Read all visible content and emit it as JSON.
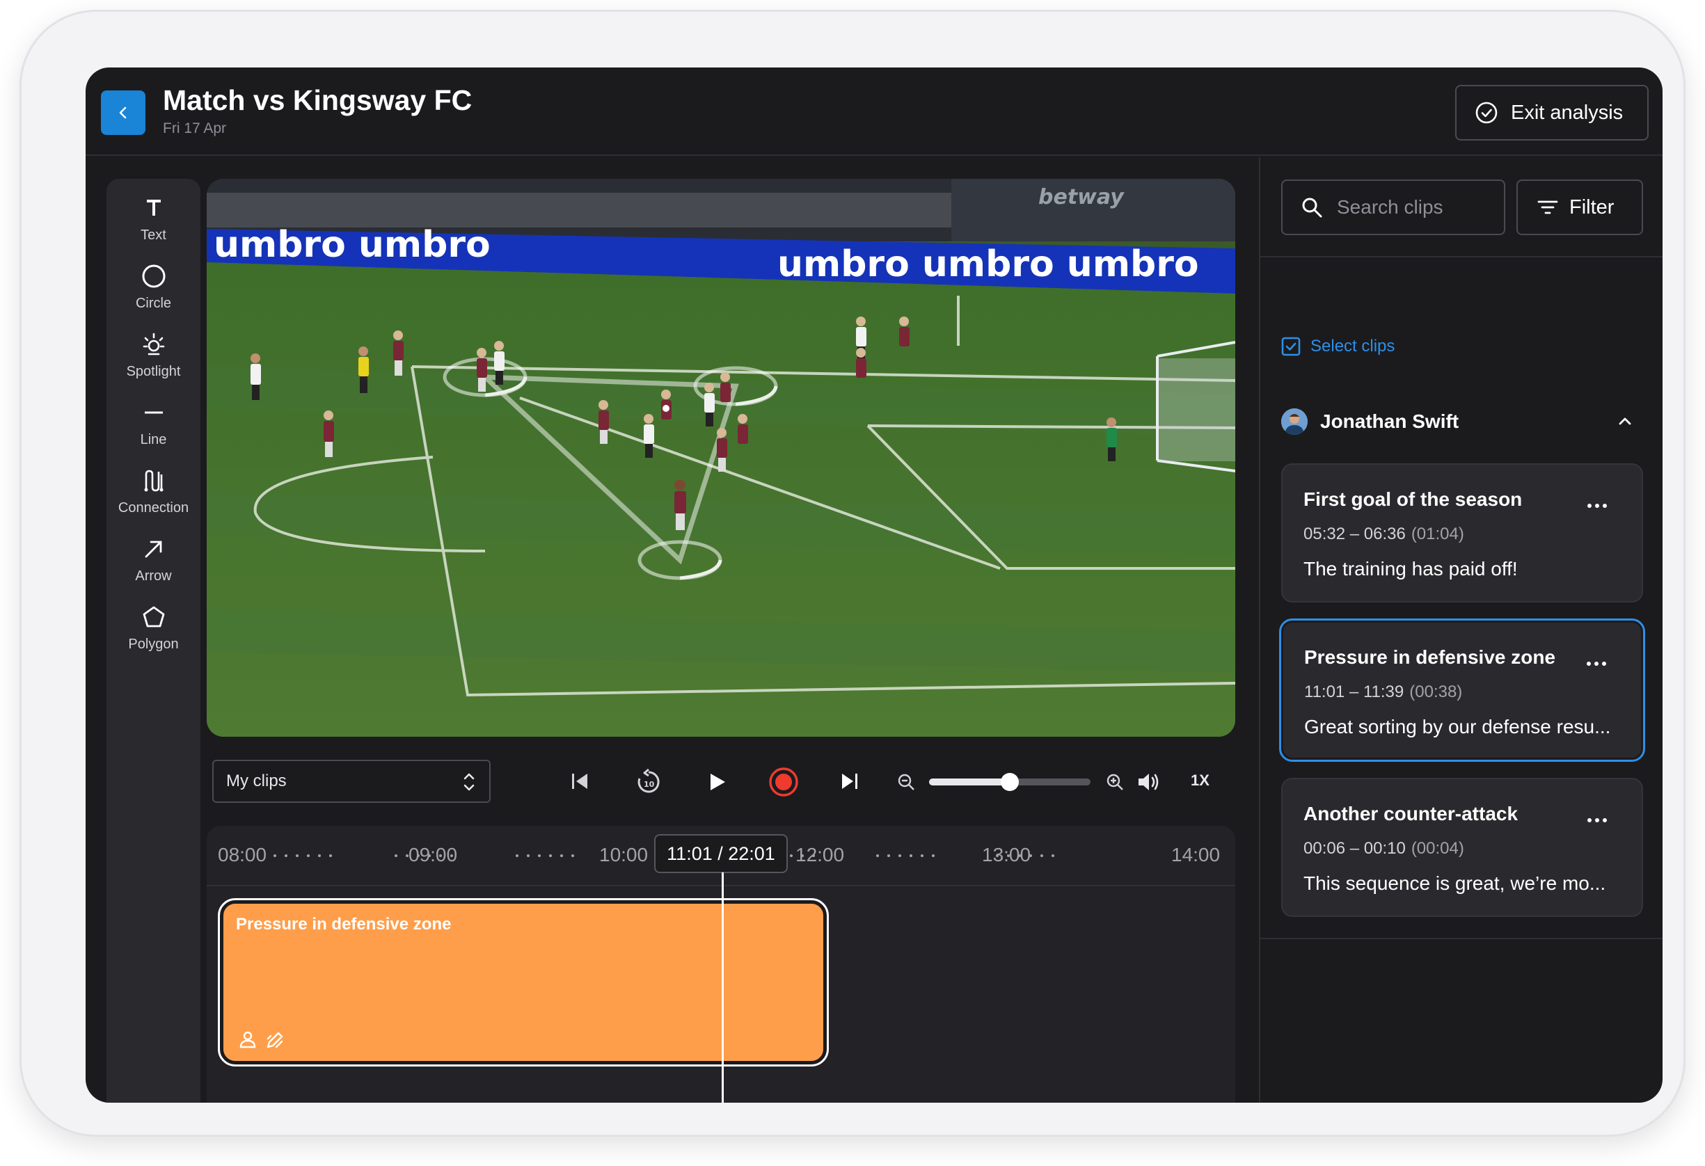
{
  "header": {
    "title": "Match vs Kingsway FC",
    "date": "Fri 17 Apr",
    "exit_label": "Exit analysis"
  },
  "toolbar": {
    "tools": [
      {
        "label": "Text",
        "icon": "text-icon"
      },
      {
        "label": "Circle",
        "icon": "circle-icon"
      },
      {
        "label": "Spotlight",
        "icon": "spotlight-icon"
      },
      {
        "label": "Line",
        "icon": "line-icon"
      },
      {
        "label": "Connection",
        "icon": "connection-icon"
      },
      {
        "label": "Arrow",
        "icon": "arrow-icon"
      },
      {
        "label": "Polygon",
        "icon": "polygon-icon"
      }
    ]
  },
  "video": {
    "banner_text": "umbro umbro",
    "banner_text_2": "umbro umbro umbro",
    "sponsor": "betway",
    "sponsor_small": "umbro"
  },
  "controls": {
    "clips_select": "My clips",
    "zoom_level": 0.5,
    "speed": "1X"
  },
  "timeline": {
    "ticks": [
      "08:00",
      "09:00",
      "10:00",
      "12:00",
      "13:00",
      "14:00"
    ],
    "current_time": "11:01 / 22:01",
    "clip_label": "Pressure in defensive zone"
  },
  "right_panel": {
    "search_placeholder": "Search clips",
    "filter_label": "Filter",
    "select_clips_label": "Select clips",
    "user_name": "Jonathan Swift",
    "clips": [
      {
        "title": "First goal of the season",
        "range": "05:32 – 06:36",
        "duration": "(01:04)",
        "description": "The training has paid off!"
      },
      {
        "title": "Pressure in defensive zone",
        "range": "11:01 – 11:39",
        "duration": "(00:38)",
        "description": "Great sorting by our defense resu..."
      },
      {
        "title": "Another counter-attack",
        "range": "00:06 – 00:10",
        "duration": "(00:04)",
        "description": "This sequence is great, we’re mo..."
      }
    ]
  },
  "colors": {
    "accent_blue": "#1a84d6",
    "clip_orange": "#ff9e4a",
    "record_red": "#f03a2e",
    "clip_green": "#35a34a"
  }
}
